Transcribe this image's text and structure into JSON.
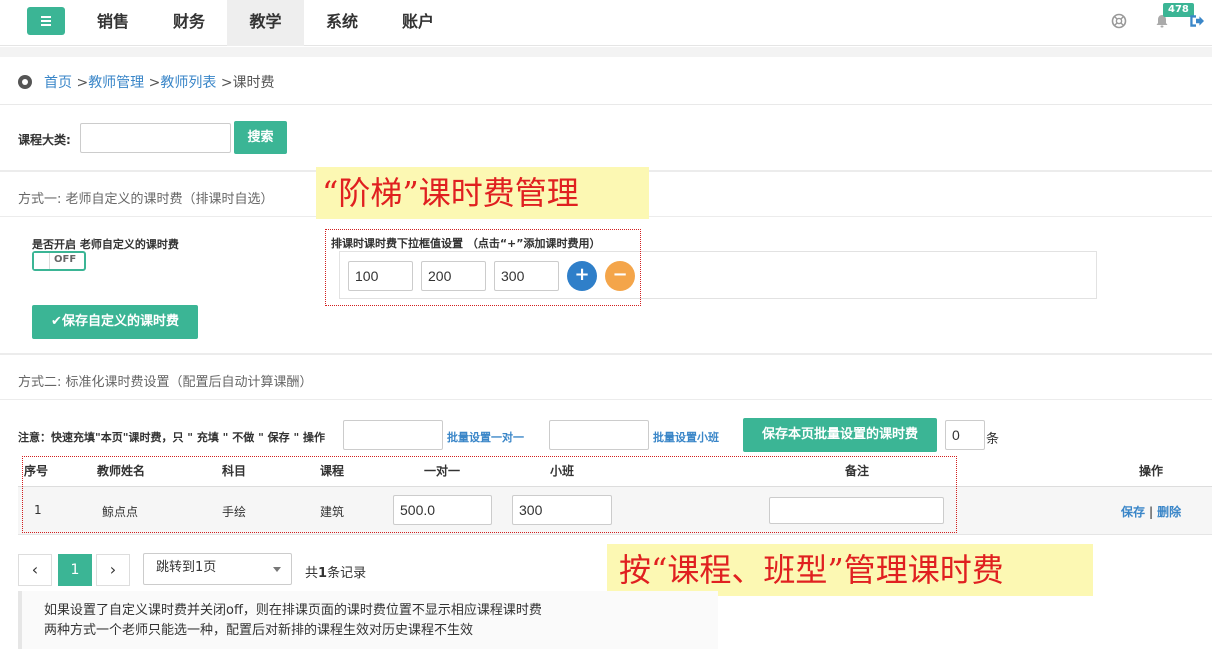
{
  "nav": {
    "items": [
      {
        "label": "销售",
        "active": false
      },
      {
        "label": "财务",
        "active": false
      },
      {
        "label": "教学",
        "active": true
      },
      {
        "label": "系统",
        "active": false
      },
      {
        "label": "账户",
        "active": false
      }
    ],
    "notification_count": "478",
    "accent_color": "#3bb595"
  },
  "breadcrumb": {
    "home": "首页",
    "sep": " >",
    "teacher_mgmt": "教师管理",
    "teacher_list": "教师列表",
    "current": "课时费"
  },
  "search": {
    "label": "课程大类:",
    "value": "",
    "button": "搜索"
  },
  "method1": {
    "title": "方式一:  老师自定义的课时费（排课时自选）",
    "annotation": "“阶梯”课时费管理",
    "enable_label": "是否开启 老师自定义的课时费",
    "toggle_state": "OFF",
    "dropdown_label": "排课时课时费下拉框值设置 （点击“+”添加课时费用）",
    "values": [
      "100",
      "200",
      "300"
    ],
    "add_symbol": "+",
    "remove_symbol": "−",
    "save_button": "✔保存自定义的课时费"
  },
  "method2": {
    "title": "方式二:  标准化课时费设置（配置后自动计算课酬）",
    "note": "注意：快速充填\"本页\"课时费，只 \" 充填 \" 不做 \" 保存 \" 操作",
    "batch_one_value": "",
    "batch_one_link": "批量设置一对一",
    "batch_small_value": "",
    "batch_small_link": "批量设置小班",
    "save_batch_button": "保存本页批量设置的课时费",
    "count_value": "0",
    "count_unit": "条",
    "annotation": "按“课程、班型”管理课时费"
  },
  "table": {
    "headers": {
      "no": "序号",
      "teacher": "教师姓名",
      "subject": "科目",
      "course": "课程",
      "one_on_one": "一对一",
      "small_class": "小班",
      "remark": "备注",
      "action": "操作"
    },
    "rows": [
      {
        "no": "1",
        "teacher": "鲸点点",
        "subject": "手绘",
        "course": "建筑",
        "one_on_one": "500.0",
        "small_class": "300",
        "remark": "",
        "save": "保存",
        "sep": "|",
        "delete": "删除"
      }
    ]
  },
  "pagination": {
    "prev": "‹",
    "current": "1",
    "next": "›",
    "jump": "跳转到1页",
    "total_prefix": "共",
    "total_num": "1",
    "total_suffix": "条记录"
  },
  "tips": [
    "如果设置了自定义课时费并关闭off，则在排课页面的课时费位置不显示相应课程课时费",
    "两种方式一个老师只能选一种，配置后对新排的课程生效对历史课程不生效"
  ]
}
